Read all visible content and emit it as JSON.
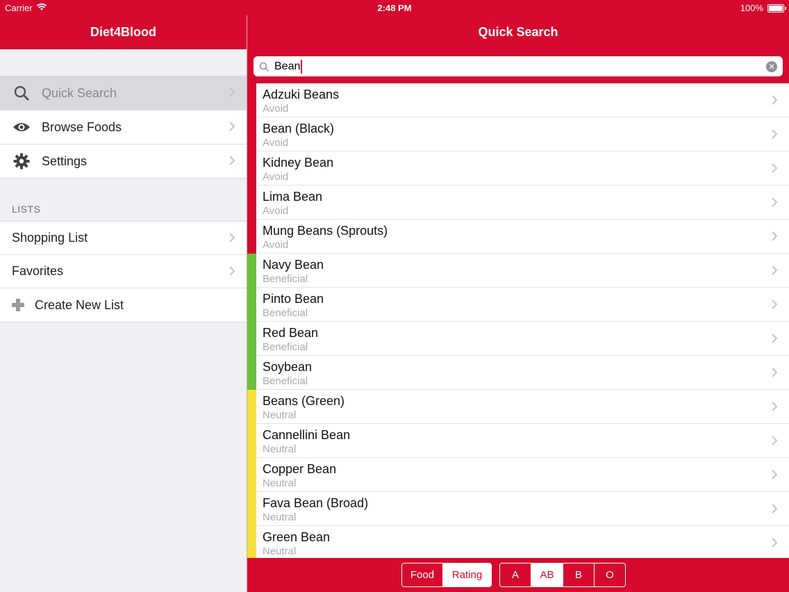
{
  "status": {
    "carrier": "Carrier",
    "time": "2:48 PM",
    "battery": "100%"
  },
  "sidebar": {
    "title": "Diet4Blood",
    "menu": [
      {
        "label": "Quick Search",
        "icon": "search-icon"
      },
      {
        "label": "Browse Foods",
        "icon": "eye-icon"
      },
      {
        "label": "Settings",
        "icon": "gear-icon"
      }
    ],
    "lists_header": "LISTS",
    "lists": [
      {
        "label": "Shopping List"
      },
      {
        "label": "Favorites"
      },
      {
        "label": "Create New List",
        "icon": "plus-icon"
      }
    ]
  },
  "main": {
    "title": "Quick Search",
    "search": {
      "value": "Bean"
    },
    "foods": [
      {
        "name": "Adzuki Beans",
        "rating": "Avoid"
      },
      {
        "name": "Bean (Black)",
        "rating": "Avoid"
      },
      {
        "name": "Kidney Bean",
        "rating": "Avoid"
      },
      {
        "name": "Lima Bean",
        "rating": "Avoid"
      },
      {
        "name": "Mung Beans (Sprouts)",
        "rating": "Avoid"
      },
      {
        "name": "Navy Bean",
        "rating": "Beneficial"
      },
      {
        "name": "Pinto Bean",
        "rating": "Beneficial"
      },
      {
        "name": "Red Bean",
        "rating": "Beneficial"
      },
      {
        "name": "Soybean",
        "rating": "Beneficial"
      },
      {
        "name": "Beans (Green)",
        "rating": "Neutral"
      },
      {
        "name": "Cannellini Bean",
        "rating": "Neutral"
      },
      {
        "name": "Copper Bean",
        "rating": "Neutral"
      },
      {
        "name": "Fava Bean (Broad)",
        "rating": "Neutral"
      },
      {
        "name": "Green Bean",
        "rating": "Neutral"
      }
    ],
    "sort_segments": [
      "Food",
      "Rating"
    ],
    "sort_selected": "Rating",
    "blood_segments": [
      "A",
      "AB",
      "B",
      "O"
    ],
    "blood_selected": "AB"
  },
  "colors": {
    "brand": "#d50a2e",
    "avoid": "#d50a2e",
    "beneficial": "#6cbf3a",
    "neutral": "#f5df3a"
  }
}
